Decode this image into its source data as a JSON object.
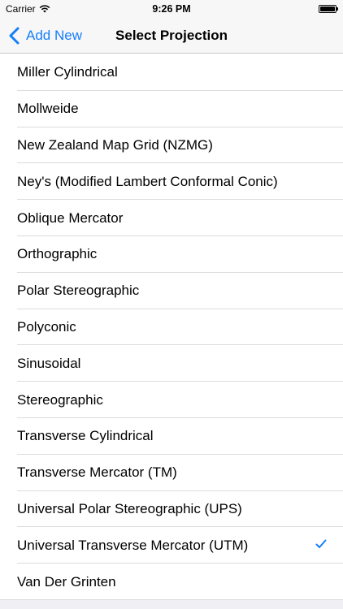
{
  "status_bar": {
    "carrier": "Carrier",
    "time": "9:26 PM",
    "icons": [
      "wifi-icon",
      "battery-icon"
    ]
  },
  "nav": {
    "back_label": "Add New",
    "back_icon": "chevron-left-icon",
    "title": "Select Projection",
    "accent_color": "#157efb"
  },
  "projections": [
    {
      "label": "Miller Cylindrical",
      "selected": false
    },
    {
      "label": "Mollweide",
      "selected": false
    },
    {
      "label": "New Zealand Map Grid (NZMG)",
      "selected": false
    },
    {
      "label": "Ney's (Modified Lambert Conformal Conic)",
      "selected": false
    },
    {
      "label": "Oblique Mercator",
      "selected": false
    },
    {
      "label": "Orthographic",
      "selected": false
    },
    {
      "label": "Polar Stereographic",
      "selected": false
    },
    {
      "label": "Polyconic",
      "selected": false
    },
    {
      "label": "Sinusoidal",
      "selected": false
    },
    {
      "label": "Stereographic",
      "selected": false
    },
    {
      "label": "Transverse Cylindrical",
      "selected": false
    },
    {
      "label": "Transverse Mercator (TM)",
      "selected": false
    },
    {
      "label": "Universal Polar Stereographic (UPS)",
      "selected": false
    },
    {
      "label": "Universal Transverse Mercator (UTM)",
      "selected": true
    },
    {
      "label": "Van Der Grinten",
      "selected": false
    }
  ],
  "selected_icon": "checkmark-icon"
}
